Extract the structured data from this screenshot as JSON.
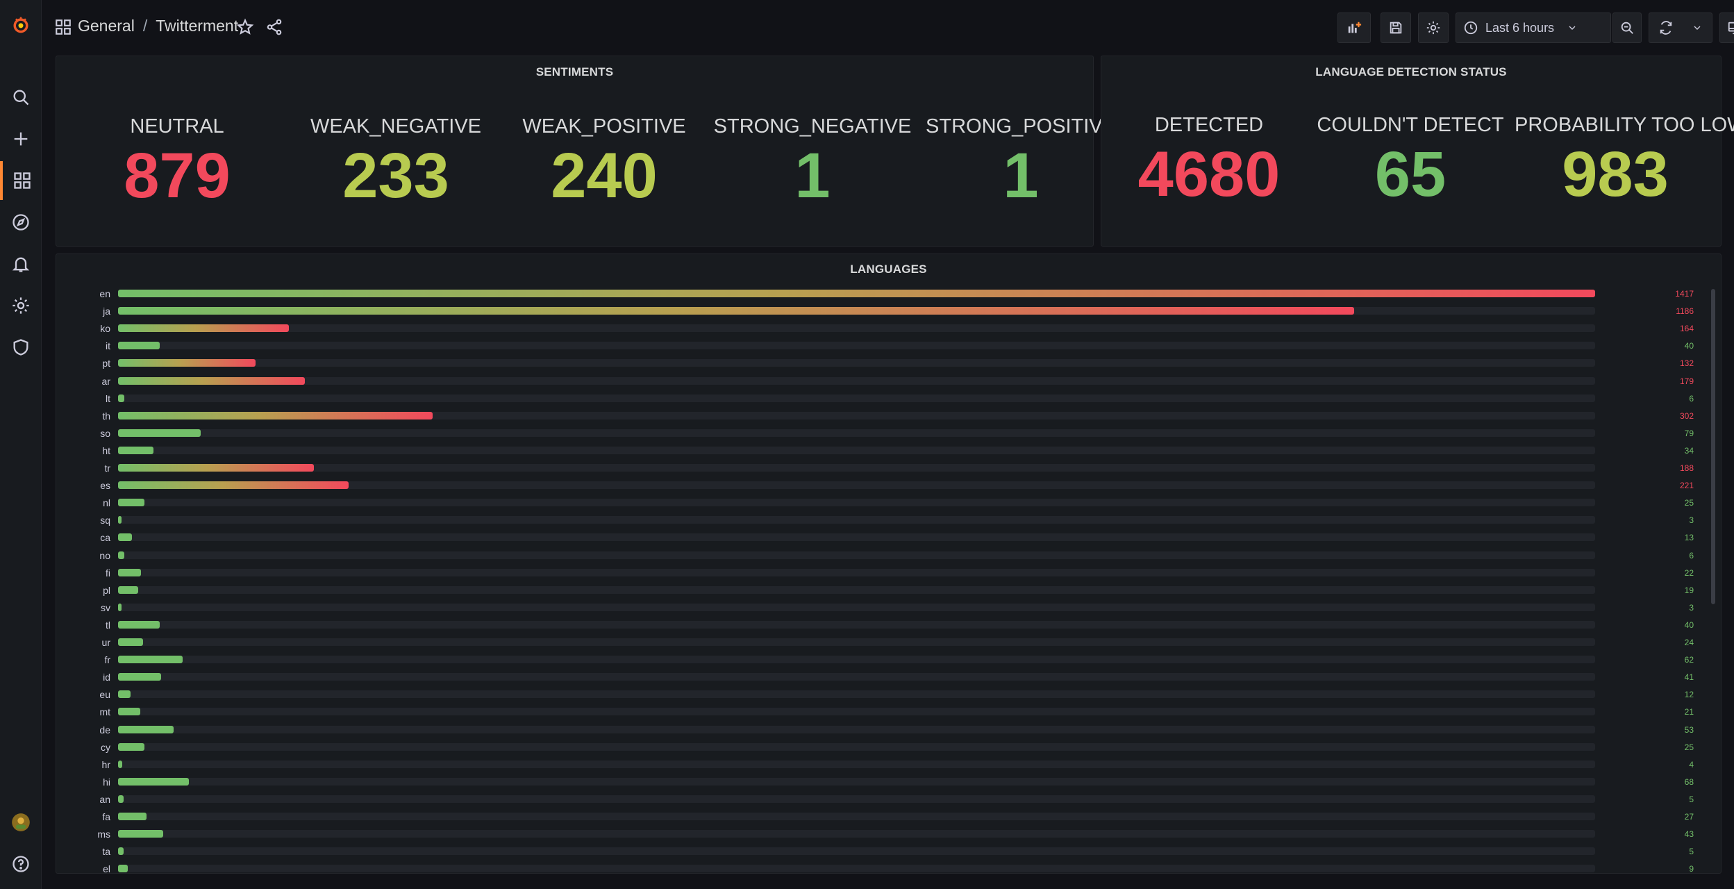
{
  "header": {
    "folder": "General",
    "separator": "/",
    "dashboard": "Twitterment",
    "time_range": "Last 6 hours"
  },
  "colors": {
    "red": "#f2495c",
    "green": "#73bf69",
    "yellow_green": "#b8cb50",
    "accent": "#ff8833"
  },
  "sidebar": {
    "items": [
      "grafana-logo",
      "search-icon",
      "plus-icon",
      "dashboards-icon",
      "explore-icon",
      "alerting-icon",
      "configuration-icon",
      "shield-icon",
      "user-avatar",
      "help-icon"
    ]
  },
  "sentiments": {
    "title": "SENTIMENTS",
    "stats": [
      {
        "label": "NEUTRAL",
        "value": "879",
        "color": "#f2495c"
      },
      {
        "label": "WEAK_NEGATIVE",
        "value": "233",
        "color": "#b8cb50"
      },
      {
        "label": "WEAK_POSITIVE",
        "value": "240",
        "color": "#b8cb50"
      },
      {
        "label": "STRONG_NEGATIVE",
        "value": "1",
        "color": "#73bf69"
      },
      {
        "label": "STRONG_POSITIVE",
        "value": "1",
        "color": "#73bf69"
      }
    ]
  },
  "detection": {
    "title": "LANGUAGE DETECTION STATUS",
    "stats": [
      {
        "label": "DETECTED",
        "value": "4680",
        "color": "#f2495c"
      },
      {
        "label": "COULDN'T DETECT",
        "value": "65",
        "color": "#73bf69"
      },
      {
        "label": "PROBABILITY TOO LOW",
        "value": "983",
        "color": "#b8cb50"
      }
    ]
  },
  "languages": {
    "title": "LANGUAGES"
  },
  "chart_data": {
    "type": "bar",
    "orientation": "horizontal",
    "title": "LANGUAGES",
    "xlim": [
      0,
      1417
    ],
    "categories": [
      "en",
      "ja",
      "ko",
      "it",
      "pt",
      "ar",
      "lt",
      "th",
      "so",
      "ht",
      "tr",
      "es",
      "nl",
      "sq",
      "ca",
      "no",
      "fi",
      "pl",
      "sv",
      "tl",
      "ur",
      "fr",
      "id",
      "eu",
      "mt",
      "de",
      "cy",
      "hr",
      "hi",
      "an",
      "fa",
      "ms",
      "ta",
      "el"
    ],
    "values": [
      1417,
      1186,
      164,
      40,
      132,
      179,
      6,
      302,
      79,
      34,
      188,
      221,
      25,
      3,
      13,
      6,
      22,
      19,
      3,
      40,
      24,
      62,
      41,
      12,
      21,
      53,
      25,
      4,
      68,
      5,
      27,
      43,
      5,
      9
    ]
  }
}
